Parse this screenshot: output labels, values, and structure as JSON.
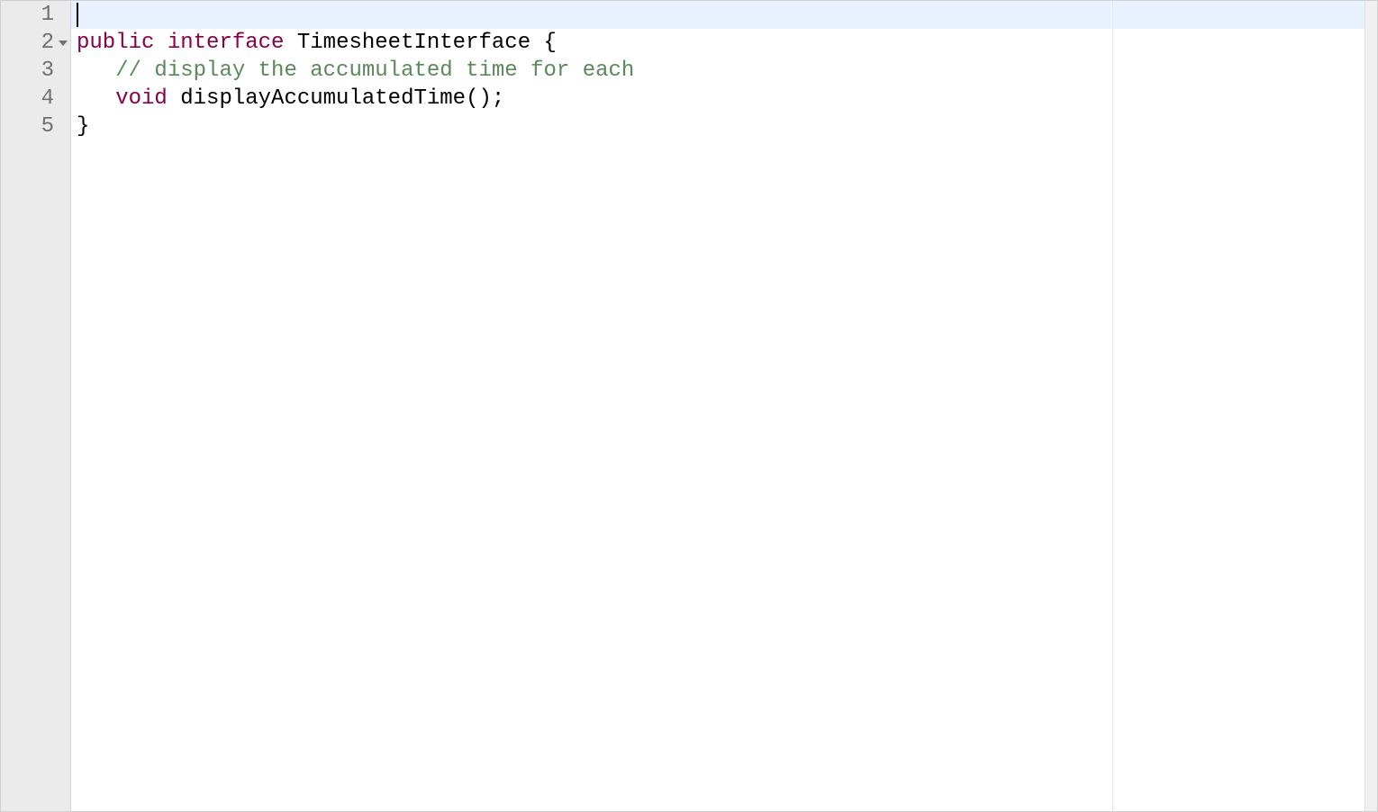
{
  "editor": {
    "activeLine": 1,
    "lines": [
      {
        "number": "1",
        "foldable": false,
        "tokens": []
      },
      {
        "number": "2",
        "foldable": true,
        "tokens": [
          {
            "type": "keyword",
            "text": "public"
          },
          {
            "type": "plain",
            "text": " "
          },
          {
            "type": "keyword",
            "text": "interface"
          },
          {
            "type": "plain",
            "text": " TimesheetInterface {"
          }
        ]
      },
      {
        "number": "3",
        "foldable": false,
        "tokens": [
          {
            "type": "plain",
            "text": "   "
          },
          {
            "type": "comment",
            "text": "// display the accumulated time for each"
          }
        ]
      },
      {
        "number": "4",
        "foldable": false,
        "tokens": [
          {
            "type": "plain",
            "text": "   "
          },
          {
            "type": "keyword",
            "text": "void"
          },
          {
            "type": "plain",
            "text": " displayAccumulatedTime();"
          }
        ]
      },
      {
        "number": "5",
        "foldable": false,
        "tokens": [
          {
            "type": "plain",
            "text": "}"
          }
        ]
      }
    ]
  }
}
